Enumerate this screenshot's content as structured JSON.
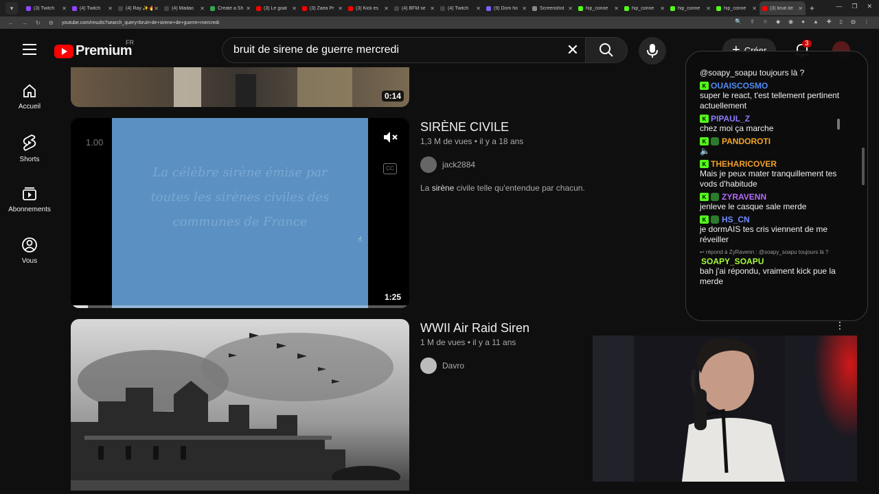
{
  "browser": {
    "tabs": [
      {
        "label": "(3) Twitch",
        "color": "#9146ff"
      },
      {
        "label": "(4) Twitch",
        "color": "#9146ff"
      },
      {
        "label": "(4) Ray ✨🔥",
        "color": "#444"
      },
      {
        "label": "(4) Madao",
        "color": "#444"
      },
      {
        "label": "Create a Sh",
        "color": "#34a853"
      },
      {
        "label": "(3) Le goat",
        "color": "#ff0000"
      },
      {
        "label": "(3) Zaea Pr",
        "color": "#ff0000"
      },
      {
        "label": "(3) Kick es",
        "color": "#ff0000"
      },
      {
        "label": "(4) BFM se",
        "color": "#444"
      },
      {
        "label": "(4) Twitch",
        "color": "#444"
      },
      {
        "label": "(9) Dom ho",
        "color": "#7b61ff"
      },
      {
        "label": "Screenshot",
        "color": "#888"
      },
      {
        "label": "hip_conne",
        "color": "#53fc18"
      },
      {
        "label": "hip_conne",
        "color": "#53fc18"
      },
      {
        "label": "hip_conne",
        "color": "#53fc18"
      },
      {
        "label": "hip_conne",
        "color": "#53fc18"
      },
      {
        "label": "(3) bruit de",
        "color": "#ff0000",
        "active": true
      }
    ],
    "url": "youtube.com/results?search_query=bruit+de+sirene+de+guerre+mercredi"
  },
  "header": {
    "brand": "Premium",
    "region": "FR",
    "search_value": "bruit de sirene de guerre mercredi",
    "create_label": "Créer",
    "notif_count": "3"
  },
  "sidebar": {
    "items": [
      {
        "label": "Accueil",
        "icon": "home-icon"
      },
      {
        "label": "Shorts",
        "icon": "shorts-icon"
      },
      {
        "label": "Abonnements",
        "icon": "subscriptions-icon"
      },
      {
        "label": "Vous",
        "icon": "you-icon"
      }
    ]
  },
  "results": [
    {
      "duration": "0:14"
    },
    {
      "title": "SIRÈNE CIVILE",
      "views": "1,3 M de vues",
      "age": "il y a 18 ans",
      "channel": "jack2884",
      "desc_bold": "sirène",
      "desc_pre": "La ",
      "desc_post": " civile telle qu'entendue par chacun.",
      "duration": "1:25",
      "speed": "1.00",
      "overlay_text": [
        "La célèbre sirène émise par",
        "toutes les sirènes civiles des",
        "communes de France"
      ],
      "progress": 0.05
    },
    {
      "title": "WWII Air Raid Siren",
      "views": "1 M de vues",
      "age": "il y a 11 ans",
      "channel": "Davro"
    }
  ],
  "chat": {
    "top_partial": "@soapy_soapu toujours là ?",
    "messages": [
      {
        "user": "OUAISCOSMO",
        "color": "#4f8df7",
        "text": "super le react, t'est tellement pertinent actuellement",
        "badge2": false
      },
      {
        "user": "PIPAUL_Z",
        "color": "#8c7cff",
        "text": "chez moi ça marche",
        "badge2": false
      },
      {
        "user": "PANDOROTI",
        "color": "#f5a623",
        "text": "🔈",
        "badge2": true
      },
      {
        "user": "THEHARICOVER",
        "color": "#f0a02c",
        "text": "Mais je peux mater tranquillement tes vods d'habitude",
        "badge2": false
      },
      {
        "user": "ZYRAVENN",
        "color": "#b36bff",
        "text": "jenleve le casque sale merde",
        "badge2": true
      },
      {
        "user": "HS_CN",
        "color": "#6f8cff",
        "text": "je dormAIS tes cris viennent de me réveiller",
        "badge2": true
      }
    ],
    "reply_note": "↩ répond à ZyRavenn : @soapy_soapu toujours là ?",
    "reply_user": "SOAPY_SOAPU",
    "reply_color": "#a6ff3c",
    "reply_text": "bah j'ai répondu, vraiment kick pue la merde"
  }
}
